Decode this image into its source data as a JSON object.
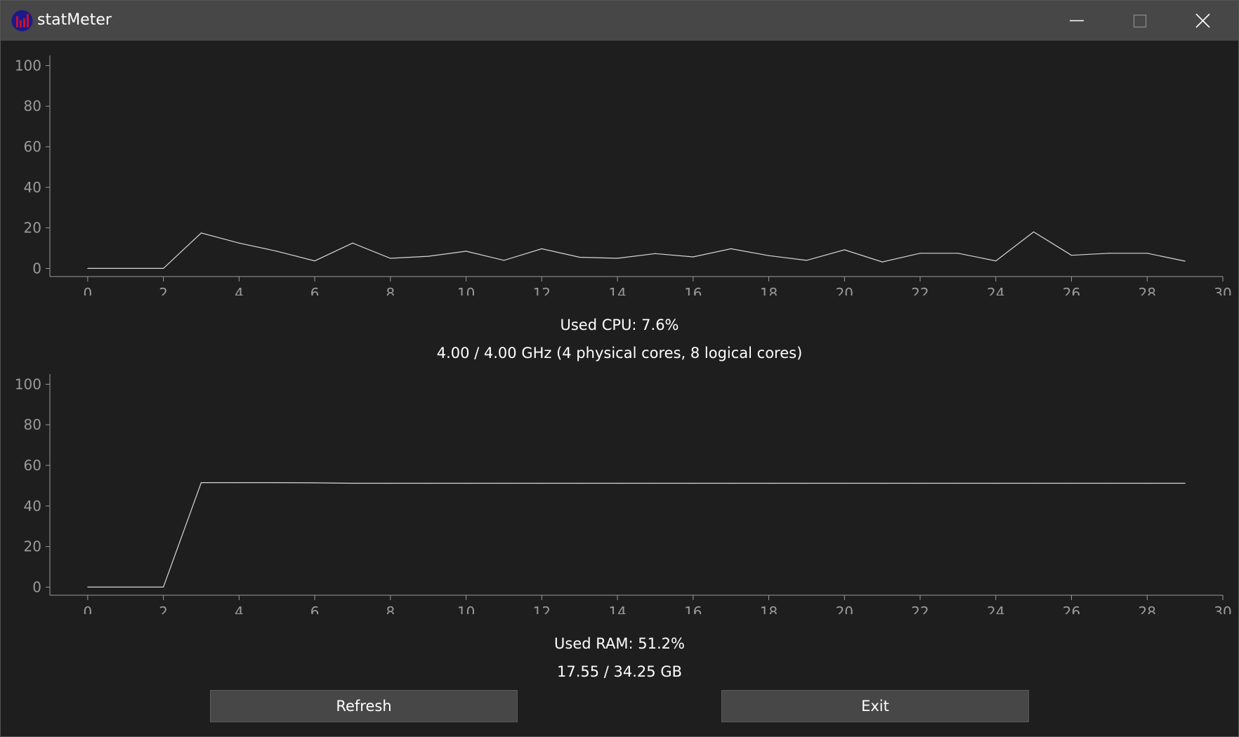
{
  "window": {
    "title": "statMeter",
    "app_icon": "bar-chart-icon",
    "controls": [
      "minimize-icon",
      "maximize-icon",
      "close-icon"
    ]
  },
  "colors": {
    "background": "#1e1e1e",
    "titlebar": "#474747",
    "axis": "#9b9b9b",
    "line": "#d8d8d8",
    "button": "#474747",
    "icon_bg": "#1a1a8c",
    "icon_bars": "#c8102e"
  },
  "cpu": {
    "used_label": "Used CPU: 7.6%",
    "freq_label": "4.00 / 4.00 GHz (4 physical cores, 8 logical cores)"
  },
  "ram": {
    "used_label": "Used RAM: 51.2%",
    "size_label": "17.55 / 34.25 GB"
  },
  "buttons": {
    "refresh": "Refresh",
    "exit": "Exit"
  },
  "chart_data": [
    {
      "type": "line",
      "xlim": [
        -1,
        30
      ],
      "ylim": [
        -4,
        105
      ],
      "xticks": [
        0,
        2,
        4,
        6,
        8,
        10,
        12,
        14,
        16,
        18,
        20,
        22,
        24,
        26,
        28,
        30
      ],
      "yticks": [
        0,
        20,
        40,
        60,
        80,
        100
      ],
      "grid": false,
      "x": [
        0,
        1,
        2,
        3,
        4,
        5,
        6,
        7,
        8,
        9,
        10,
        11,
        12,
        13,
        14,
        15,
        16,
        17,
        18,
        19,
        20,
        21,
        22,
        23,
        24,
        25,
        26,
        27,
        28,
        29
      ],
      "series": [
        {
          "values": [
            0,
            0,
            0,
            17.5,
            12.5,
            8.5,
            3.7,
            12.5,
            5,
            6,
            8.5,
            4,
            9.7,
            5.5,
            5,
            7.3,
            5.7,
            9.7,
            6.3,
            4,
            9.2,
            3.2,
            7.5,
            7.5,
            3.7,
            18,
            6.5,
            7.5,
            7.5,
            3.6
          ]
        }
      ]
    },
    {
      "type": "line",
      "xlim": [
        -1,
        30
      ],
      "ylim": [
        -4,
        105
      ],
      "xticks": [
        0,
        2,
        4,
        6,
        8,
        10,
        12,
        14,
        16,
        18,
        20,
        22,
        24,
        26,
        28,
        30
      ],
      "yticks": [
        0,
        20,
        40,
        60,
        80,
        100
      ],
      "grid": false,
      "x": [
        0,
        1,
        2,
        3,
        4,
        5,
        6,
        7,
        8,
        9,
        10,
        11,
        12,
        13,
        14,
        15,
        16,
        17,
        18,
        19,
        20,
        21,
        22,
        23,
        24,
        25,
        26,
        27,
        28,
        29
      ],
      "series": [
        {
          "values": [
            0,
            0,
            0,
            51.5,
            51.5,
            51.5,
            51.4,
            51.2,
            51.2,
            51.2,
            51.2,
            51.2,
            51.2,
            51.2,
            51.2,
            51.2,
            51.2,
            51.2,
            51.2,
            51.2,
            51.2,
            51.2,
            51.2,
            51.2,
            51.2,
            51.2,
            51.2,
            51.2,
            51.2,
            51.2
          ]
        }
      ]
    }
  ]
}
